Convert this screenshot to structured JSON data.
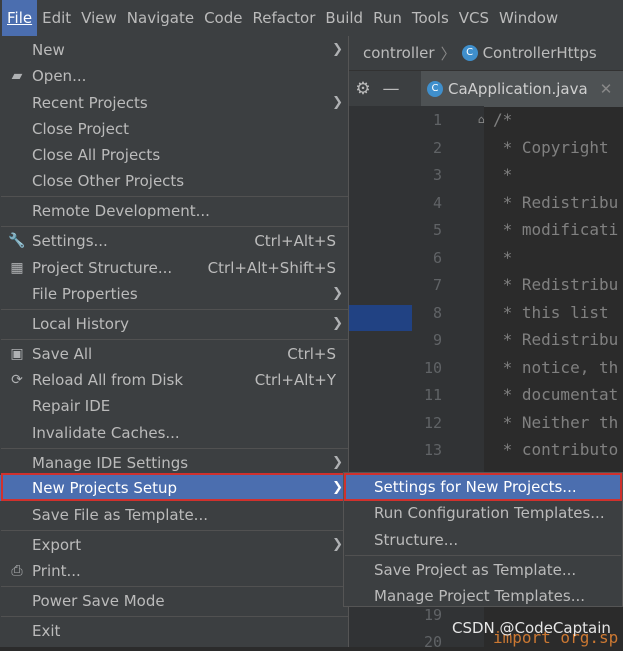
{
  "menubar": {
    "items": [
      "File",
      "Edit",
      "View",
      "Navigate",
      "Code",
      "Refactor",
      "Build",
      "Run",
      "Tools",
      "VCS",
      "Window"
    ]
  },
  "breadcrumb": {
    "part1": "controller",
    "part2": "ControllerHttps"
  },
  "editor_tab": {
    "filename": "CaApplication.java"
  },
  "code": {
    "line_numbers": [
      "1",
      "2",
      "3",
      "4",
      "5",
      "6",
      "7",
      "8",
      "9",
      "10",
      "11",
      "12",
      "13",
      "19",
      "20"
    ],
    "lines": [
      "/*",
      " * Copyright",
      " *",
      " * Redistribu",
      " * modificati",
      " *",
      " * Redistribu",
      " * this list",
      " * Redistribu",
      " * notice, th",
      " * documentat",
      " * Neither th",
      " * contributo"
    ],
    "import_line": "import org.sp"
  },
  "file_menu": {
    "new": "New",
    "open": "Open...",
    "recent_projects": "Recent Projects",
    "close_project": "Close Project",
    "close_all_projects": "Close All Projects",
    "close_other_projects": "Close Other Projects",
    "remote_development": "Remote Development...",
    "settings": "Settings...",
    "settings_shortcut": "Ctrl+Alt+S",
    "project_structure": "Project Structure...",
    "project_structure_shortcut": "Ctrl+Alt+Shift+S",
    "file_properties": "File Properties",
    "local_history": "Local History",
    "save_all": "Save All",
    "save_all_shortcut": "Ctrl+S",
    "reload_all": "Reload All from Disk",
    "reload_all_shortcut": "Ctrl+Alt+Y",
    "repair_ide": "Repair IDE",
    "invalidate_caches": "Invalidate Caches...",
    "manage_ide_settings": "Manage IDE Settings",
    "new_projects_setup": "New Projects Setup",
    "save_file_as_template": "Save File as Template...",
    "export": "Export",
    "print": "Print...",
    "power_save_mode": "Power Save Mode",
    "exit": "Exit"
  },
  "submenu": {
    "settings_for_new_projects": "Settings for New Projects...",
    "run_configuration_templates": "Run Configuration Templates...",
    "structure": "Structure...",
    "save_project_as_template": "Save Project as Template...",
    "manage_project_templates": "Manage Project Templates..."
  },
  "watermark": "CSDN @CodeCaptain",
  "colors": {
    "highlight": "#4b6eaf",
    "outline": "#d0312d",
    "menu_bg": "#3c3f41"
  }
}
